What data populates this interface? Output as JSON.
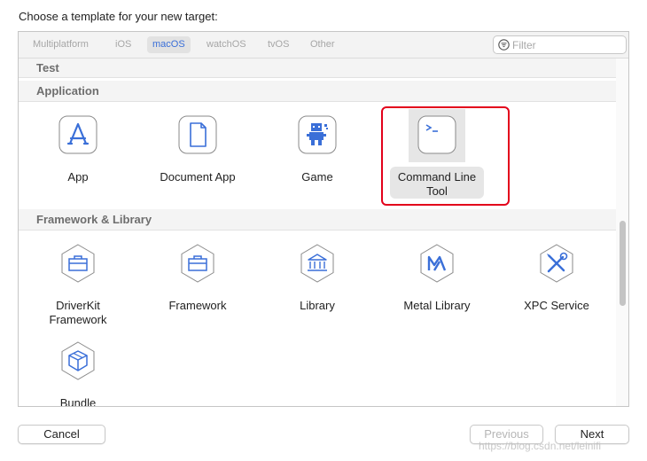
{
  "heading": "Choose a template for your new target:",
  "platform_tabs": [
    {
      "label": "Multiplatform",
      "selected": false
    },
    {
      "label": "iOS",
      "selected": false
    },
    {
      "label": "macOS",
      "selected": true
    },
    {
      "label": "watchOS",
      "selected": false
    },
    {
      "label": "tvOS",
      "selected": false
    },
    {
      "label": "Other",
      "selected": false
    }
  ],
  "filter": {
    "placeholder": "Filter",
    "value": ""
  },
  "sections": {
    "test": "Test",
    "application": "Application",
    "framework": "Framework & Library"
  },
  "application_items": [
    {
      "label": "App",
      "icon": "app-store-icon"
    },
    {
      "label": "Document App",
      "icon": "document-icon"
    },
    {
      "label": "Game",
      "icon": "game-icon"
    },
    {
      "label": "Command Line Tool",
      "icon": "terminal-icon",
      "selected": true
    }
  ],
  "framework_items": [
    {
      "label": "DriverKit Framework",
      "icon": "toolbox-icon"
    },
    {
      "label": "Framework",
      "icon": "toolbox-icon"
    },
    {
      "label": "Library",
      "icon": "library-icon"
    },
    {
      "label": "Metal Library",
      "icon": "metal-icon"
    },
    {
      "label": "XPC Service",
      "icon": "tools-icon"
    },
    {
      "label": "Bundle",
      "icon": "bundle-icon"
    }
  ],
  "buttons": {
    "cancel": "Cancel",
    "previous": "Previous",
    "next": "Next"
  },
  "watermark": "https://blog.csdn.net/leinifi",
  "colors": {
    "accent": "#3a6fd8",
    "highlight": "#e3001b"
  }
}
